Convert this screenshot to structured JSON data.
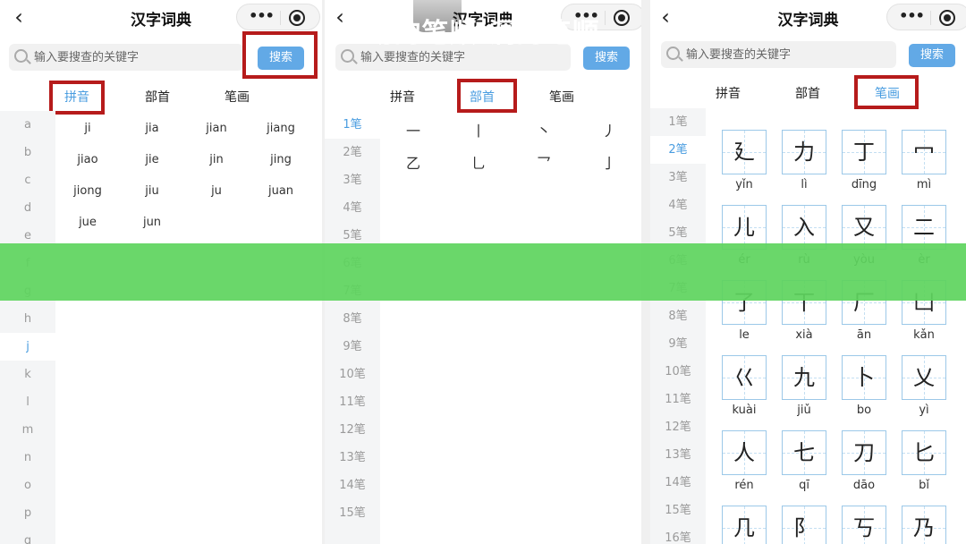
{
  "title": "汉字词典",
  "search": {
    "placeholder": "输入要搜查的关键字",
    "button": "搜索"
  },
  "tabs": [
    "拼音",
    "部首",
    "笔画"
  ],
  "accent_color": "#4a9de0",
  "button_color": "#62a9e6",
  "highlight_color": "#b61b1b",
  "banner_color": "#5fd45f",
  "icons": {
    "back": "chevron-left-icon",
    "more": "more-dots-icon",
    "target": "target-icon",
    "search": "search-icon"
  },
  "letters": [
    "a",
    "b",
    "c",
    "d",
    "e",
    "f",
    "g",
    "h",
    "j",
    "k",
    "l",
    "m",
    "n",
    "o",
    "p",
    "q"
  ],
  "active_letter": "j",
  "pinyin": [
    "ji",
    "jia",
    "jian",
    "jiang",
    "jiao",
    "jie",
    "jin",
    "jing",
    "jiong",
    "jiu",
    "ju",
    "juan",
    "jue",
    "jun"
  ],
  "stroke_counts_2": [
    "1笔",
    "2笔",
    "3笔",
    "4笔",
    "5笔",
    "6笔",
    "7笔",
    "8笔",
    "9笔",
    "10笔",
    "11笔",
    "12笔",
    "13笔",
    "14笔",
    "15笔"
  ],
  "stroke_counts_3": [
    "1笔",
    "2笔",
    "3笔",
    "4笔",
    "5笔",
    "6笔",
    "7笔",
    "8笔",
    "9笔",
    "10笔",
    "11笔",
    "12笔",
    "13笔",
    "14笔",
    "15笔",
    "16笔"
  ],
  "strokes": [
    "一",
    "丨",
    "丶",
    "丿",
    "乙",
    "乚",
    "乛",
    "亅"
  ],
  "chars": [
    {
      "c": "廴",
      "p": "yǐn"
    },
    {
      "c": "力",
      "p": "lì"
    },
    {
      "c": "丁",
      "p": "dīng"
    },
    {
      "c": "冖",
      "p": "mì"
    },
    {
      "c": "儿",
      "p": "ér"
    },
    {
      "c": "入",
      "p": "rù"
    },
    {
      "c": "又",
      "p": "yòu"
    },
    {
      "c": "二",
      "p": "èr"
    },
    {
      "c": "了",
      "p": "le"
    },
    {
      "c": "丅",
      "p": "xià"
    },
    {
      "c": "厂",
      "p": "ān"
    },
    {
      "c": "凵",
      "p": "kǎn"
    },
    {
      "c": "巜",
      "p": "kuài"
    },
    {
      "c": "九",
      "p": "jiǔ"
    },
    {
      "c": "卜",
      "p": "bo"
    },
    {
      "c": "乂",
      "p": "yì"
    },
    {
      "c": "人",
      "p": "rén"
    },
    {
      "c": "七",
      "p": "qī"
    },
    {
      "c": "刀",
      "p": "dāo"
    },
    {
      "c": "匕",
      "p": "bǐ"
    },
    {
      "c": "几",
      "p": ""
    },
    {
      "c": "阝",
      "p": ""
    },
    {
      "c": "丂",
      "p": ""
    },
    {
      "c": "乃",
      "p": ""
    }
  ],
  "banner": "动的笔顺:洞的笔顺"
}
